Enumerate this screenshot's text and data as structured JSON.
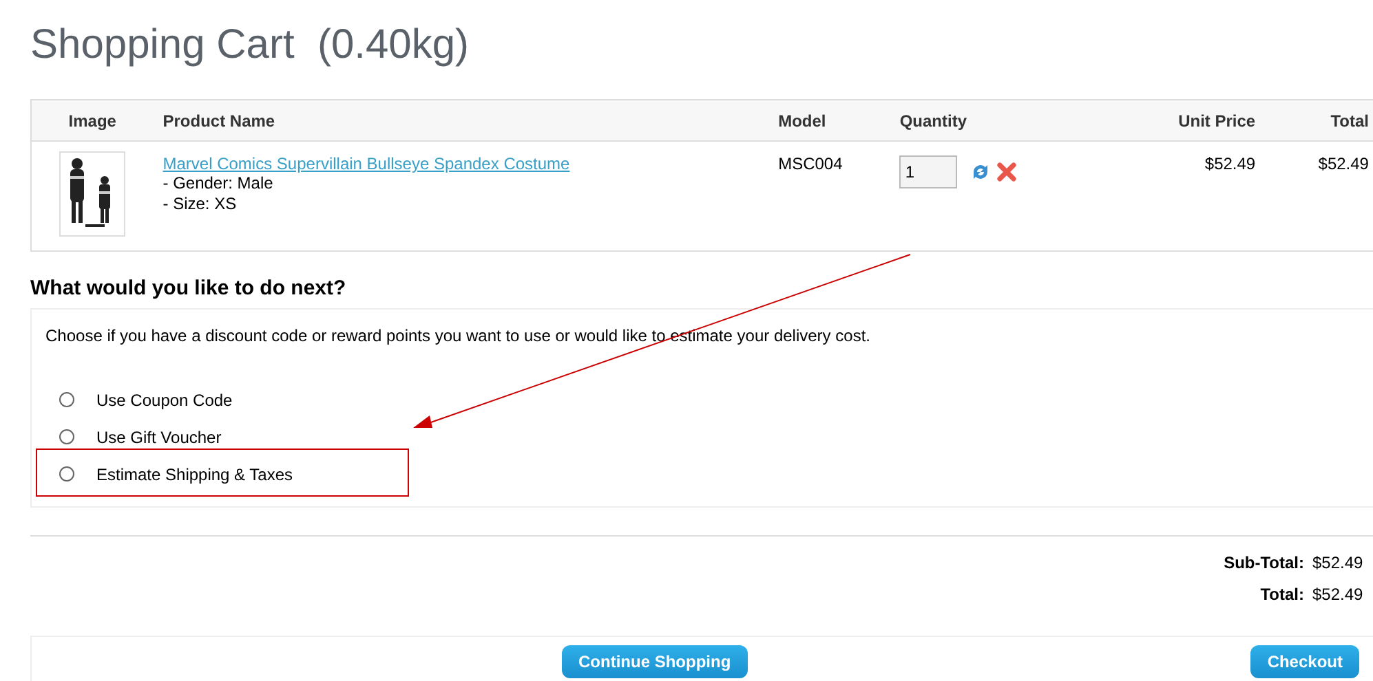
{
  "page_title": "Shopping Cart  (0.40kg)",
  "cart_table": {
    "columns": [
      "Image",
      "Product Name",
      "Model",
      "Quantity",
      "Unit Price",
      "Total"
    ],
    "rows": [
      {
        "product_name": "Marvel Comics Supervillain Bullseye Spandex Costume",
        "options": [
          "- Gender: Male",
          "- Size: XS"
        ],
        "model": "MSC004",
        "quantity": "1",
        "unit_price": "$52.49",
        "total": "$52.49"
      }
    ]
  },
  "next_section": {
    "heading": "What would you like to do next?",
    "description": "Choose if you have a discount code or reward points you want to use or would like to estimate your delivery cost.",
    "options": [
      {
        "label": "Use Coupon Code",
        "selected": false
      },
      {
        "label": "Use Gift Voucher",
        "selected": false
      },
      {
        "label": "Estimate Shipping & Taxes",
        "selected": false,
        "highlighted": true
      }
    ]
  },
  "totals": [
    {
      "label": "Sub-Total:",
      "value": "$52.49"
    },
    {
      "label": "Total:",
      "value": "$52.49"
    }
  ],
  "buttons": [
    {
      "label": "Continue Shopping"
    },
    {
      "label": "Checkout"
    }
  ]
}
